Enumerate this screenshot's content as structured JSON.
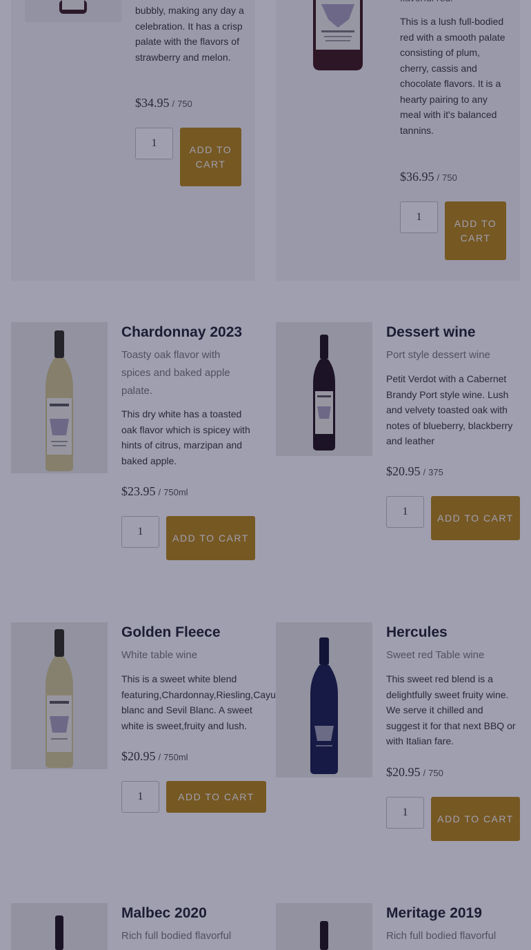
{
  "colors": {
    "accent": "#b9850f",
    "overlay": "#1a1a40",
    "title": "#1e1e2c"
  },
  "products": [
    {
      "id": "sparkling",
      "title": "",
      "subtitle": "",
      "description": "bubbly, making any day a celebration. It has a crisp palate with the flavors of strawberry and melon.",
      "price": "$34.95",
      "unit": "750",
      "qty": "1",
      "button": "ADD TO CART"
    },
    {
      "id": "red-blend",
      "title": "",
      "subtitle": "flavorful red.",
      "description": "This is a lush full-bodied red with a smooth palate consisting of plum, cherry, cassis and chocolate flavors. It is a hearty pairing to any meal with it's balanced tannins.",
      "price": "$36.95",
      "unit": "750",
      "qty": "1",
      "button": "ADD TO CART"
    },
    {
      "id": "chardonnay",
      "title": "Chardonnay 2023",
      "subtitle": "Toasty oak flavor with spices and baked apple palate.",
      "description": "This dry white has a toasted oak flavor which is spicey with hints of citrus, marzipan and baked apple.",
      "price": "$23.95",
      "unit": "750ml",
      "qty": "1",
      "button": "ADD TO CART"
    },
    {
      "id": "dessert",
      "title": "Dessert wine",
      "subtitle": "Port style dessert wine",
      "description": "Petit Verdot with a Cabernet Brandy Port style wine. Lush and velvety toasted oak with notes of blueberry, blackberry and leather",
      "price": "$20.95",
      "unit": "375",
      "qty": "1",
      "button": "ADD TO CART"
    },
    {
      "id": "golden-fleece",
      "title": "Golden Fleece",
      "subtitle": "White table wine",
      "description": "This is a sweet white blend featuring,Chardonnay,Riesling,Cayuga blanc and Sevil Blanc. A sweet white is sweet,fruity and lush.",
      "price": "$20.95",
      "unit": "750ml",
      "qty": "1",
      "button": "ADD TO CART"
    },
    {
      "id": "hercules",
      "title": "Hercules",
      "subtitle": "Sweet red Table wine",
      "description": "This sweet red blend is a delightfully sweet fruity wine. We serve it chilled and suggest it for that next BBQ or with Italian fare.",
      "price": "$20.95",
      "unit": "750",
      "qty": "1",
      "button": "ADD TO CART"
    },
    {
      "id": "malbec",
      "title": "Malbec 2020",
      "subtitle": "Rich full bodied flavorful",
      "description": "",
      "price": "",
      "unit": "",
      "qty": "",
      "button": ""
    },
    {
      "id": "meritage",
      "title": "Meritage 2019",
      "subtitle": "Rich full bodied flavorful",
      "description": "",
      "price": "",
      "unit": "",
      "qty": "",
      "button": ""
    }
  ]
}
